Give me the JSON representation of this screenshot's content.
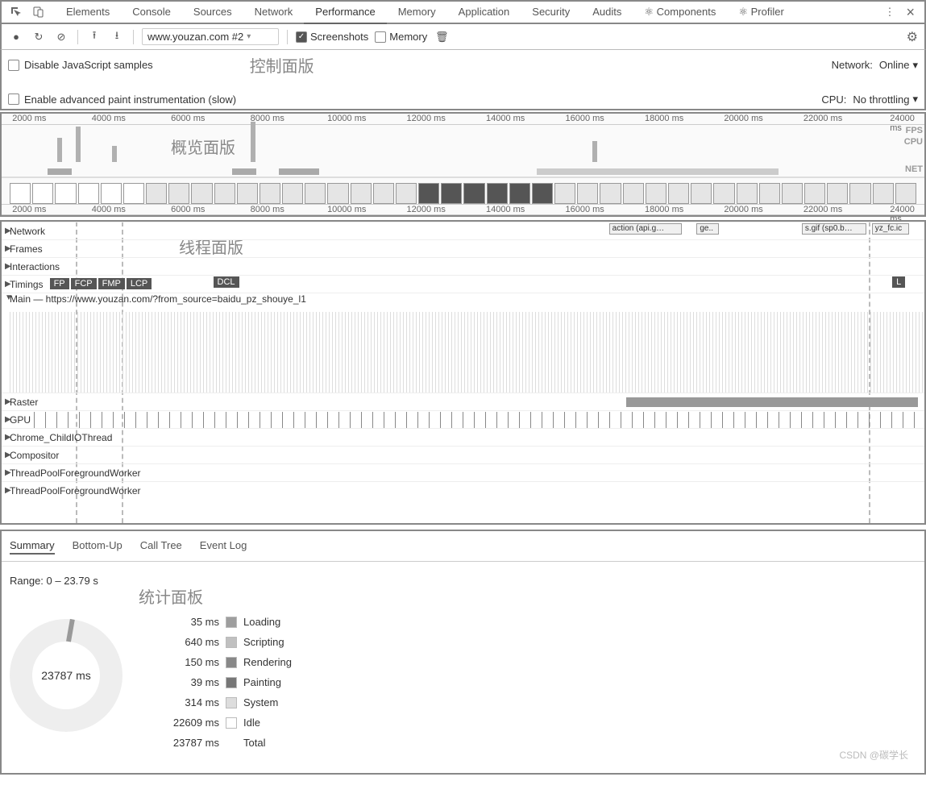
{
  "tabs": [
    "Elements",
    "Console",
    "Sources",
    "Network",
    "Performance",
    "Memory",
    "Application",
    "Security",
    "Audits",
    "⚛ Components",
    "⚛ Profiler"
  ],
  "activeTab": "Performance",
  "toolbar": {
    "record_url": "www.youzan.com #2",
    "screenshots": "Screenshots",
    "memory": "Memory"
  },
  "options": {
    "disable_js": "Disable JavaScript samples",
    "zh_control": "控制面版",
    "advanced_paint": "Enable advanced paint instrumentation (slow)",
    "network_label": "Network:",
    "network_value": "Online",
    "cpu_label": "CPU:",
    "cpu_value": "No throttling"
  },
  "overview": {
    "ticks": [
      "2000 ms",
      "4000 ms",
      "6000 ms",
      "8000 ms",
      "10000 ms",
      "12000 ms",
      "14000 ms",
      "16000 ms",
      "18000 ms",
      "20000 ms",
      "22000 ms",
      "24000 ms"
    ],
    "zh": "概览面版",
    "side": [
      "FPS",
      "CPU",
      "NET"
    ]
  },
  "threads": {
    "zh": "线程面版",
    "rows": {
      "network": "Network",
      "frames": "Frames",
      "interactions": "Interactions",
      "timings": "Timings",
      "main": "Main — https://www.youzan.com/?from_source=baidu_pz_shouye_l1",
      "raster": "Raster",
      "gpu": "GPU",
      "childio": "Chrome_ChildIOThread",
      "compositor": "Compositor",
      "tpfw1": "ThreadPoolForegroundWorker",
      "tpfw2": "ThreadPoolForegroundWorker"
    },
    "timingBadges": [
      "FP",
      "FCP",
      "FMP",
      "LCP"
    ],
    "timingDCL": "DCL",
    "timingL": "L",
    "netBoxes": [
      "action (api.g…",
      "ge..",
      "s.gif (sp0.b…",
      "yz_fc.ic"
    ]
  },
  "stats": {
    "subtabs": [
      "Summary",
      "Bottom-Up",
      "Call Tree",
      "Event Log"
    ],
    "activeSubtab": "Summary",
    "range": "Range: 0 – 23.79 s",
    "zh": "统计面板",
    "donut_center": "23787 ms",
    "legend": [
      {
        "time": "35 ms",
        "label": "Loading",
        "color": "#9e9e9e"
      },
      {
        "time": "640 ms",
        "label": "Scripting",
        "color": "#c0c0c0"
      },
      {
        "time": "150 ms",
        "label": "Rendering",
        "color": "#888888"
      },
      {
        "time": "39 ms",
        "label": "Painting",
        "color": "#777777"
      },
      {
        "time": "314 ms",
        "label": "System",
        "color": "#dddddd"
      },
      {
        "time": "22609 ms",
        "label": "Idle",
        "color": "#ffffff"
      },
      {
        "time": "23787 ms",
        "label": "Total",
        "color": ""
      }
    ]
  },
  "watermark": "CSDN @碳学长",
  "chart_data": {
    "type": "pie",
    "title": "Summary",
    "series": [
      {
        "name": "Loading",
        "value": 35
      },
      {
        "name": "Scripting",
        "value": 640
      },
      {
        "name": "Rendering",
        "value": 150
      },
      {
        "name": "Painting",
        "value": 39
      },
      {
        "name": "System",
        "value": 314
      },
      {
        "name": "Idle",
        "value": 22609
      }
    ],
    "total": 23787,
    "unit": "ms",
    "range": "0 – 23.79 s"
  }
}
